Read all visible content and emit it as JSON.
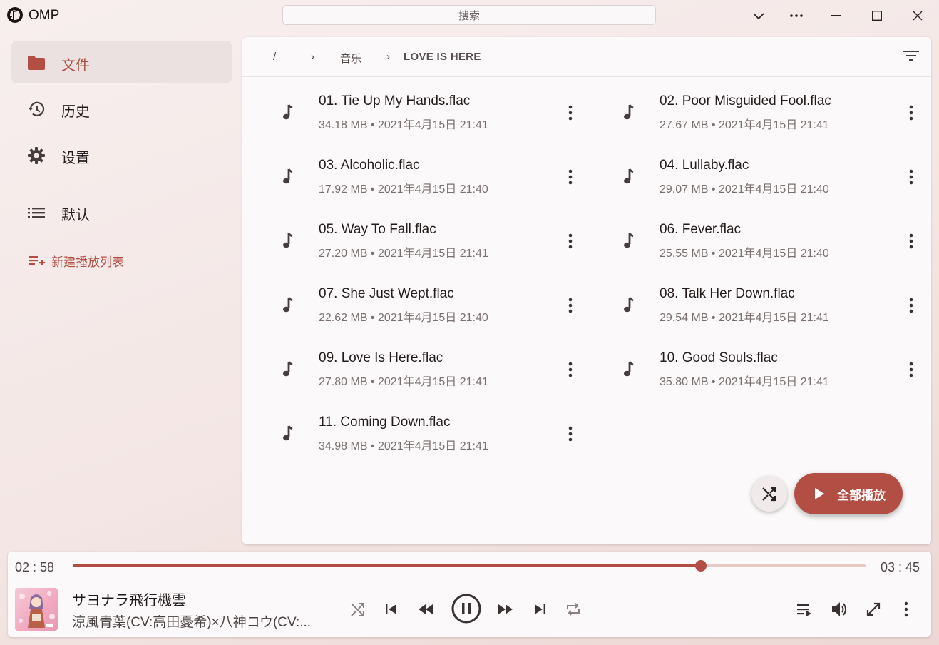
{
  "app": {
    "name": "OMP"
  },
  "search": {
    "placeholder": "搜索"
  },
  "sidebar": {
    "items": [
      {
        "label": "文件",
        "icon": "folder-icon"
      },
      {
        "label": "历史",
        "icon": "history-icon"
      },
      {
        "label": "设置",
        "icon": "gear-icon"
      }
    ],
    "playlists": [
      {
        "label": "默认",
        "icon": "list-icon"
      }
    ],
    "new_playlist_label": "新建播放列表"
  },
  "breadcrumb": {
    "root": "/",
    "sep": "›",
    "parts": [
      "音乐",
      "LOVE IS HERE"
    ]
  },
  "files": [
    {
      "name": "01. Tie Up My Hands.flac",
      "meta": "34.18 MB • 2021年4月15日 21:41"
    },
    {
      "name": "02. Poor Misguided Fool.flac",
      "meta": "27.67 MB • 2021年4月15日 21:41"
    },
    {
      "name": "03. Alcoholic.flac",
      "meta": "17.92 MB • 2021年4月15日 21:40"
    },
    {
      "name": "04. Lullaby.flac",
      "meta": "29.07 MB • 2021年4月15日 21:40"
    },
    {
      "name": "05. Way To Fall.flac",
      "meta": "27.20 MB • 2021年4月15日 21:41"
    },
    {
      "name": "06. Fever.flac",
      "meta": "25.55 MB • 2021年4月15日 21:40"
    },
    {
      "name": "07. She Just Wept.flac",
      "meta": "22.62 MB • 2021年4月15日 21:40"
    },
    {
      "name": "08. Talk Her Down.flac",
      "meta": "29.54 MB • 2021年4月15日 21:41"
    },
    {
      "name": "09. Love Is Here.flac",
      "meta": "27.80 MB • 2021年4月15日 21:41"
    },
    {
      "name": "10. Good Souls.flac",
      "meta": "35.80 MB • 2021年4月15日 21:41"
    },
    {
      "name": "11. Coming Down.flac",
      "meta": "34.98 MB • 2021年4月15日 21:41"
    }
  ],
  "actions": {
    "play_all_label": "全部播放"
  },
  "player": {
    "elapsed": "02 : 58",
    "duration": "03 : 45",
    "progress": 0.792,
    "title": "サヨナラ飛行機雲",
    "artist": "涼風青葉(CV:高田憂希)×八神コウ(CV:..."
  },
  "colors": {
    "accent": "#b24e44",
    "track": "#e6c8c4",
    "panel": "#fbf9f9"
  }
}
